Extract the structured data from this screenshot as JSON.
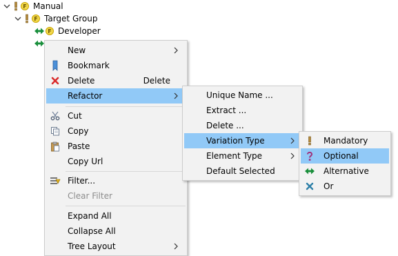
{
  "tree": {
    "items": [
      {
        "label": "Manual"
      },
      {
        "label": "Target Group"
      },
      {
        "label": "Developer"
      }
    ]
  },
  "context_menu": {
    "items": {
      "new": {
        "label": "New"
      },
      "bookmark": {
        "label": "Bookmark"
      },
      "delete": {
        "label": "Delete",
        "accelerator": "Delete"
      },
      "refactor": {
        "label": "Refactor"
      },
      "cut": {
        "label": "Cut"
      },
      "copy": {
        "label": "Copy"
      },
      "paste": {
        "label": "Paste"
      },
      "copy_url": {
        "label": "Copy Url"
      },
      "filter": {
        "label": "Filter..."
      },
      "clear_filter": {
        "label": "Clear Filter"
      },
      "expand_all": {
        "label": "Expand All"
      },
      "collapse_all": {
        "label": "Collapse All"
      },
      "tree_layout": {
        "label": "Tree Layout"
      }
    }
  },
  "refactor_menu": {
    "items": {
      "unique_name": {
        "label": "Unique Name ..."
      },
      "extract": {
        "label": "Extract ..."
      },
      "delete": {
        "label": "Delete ..."
      },
      "variation_type": {
        "label": "Variation Type"
      },
      "element_type": {
        "label": "Element Type"
      },
      "default_selected": {
        "label": "Default Selected"
      }
    }
  },
  "variation_menu": {
    "items": {
      "mandatory": {
        "label": "Mandatory"
      },
      "optional": {
        "label": "Optional"
      },
      "alternative": {
        "label": "Alternative"
      },
      "or": {
        "label": "Or"
      }
    }
  },
  "colors": {
    "selection": "#91c9f7",
    "menu_bg": "#f2f2f2",
    "feature_badge": "#f2d84a",
    "alternative": "#1a8f3c",
    "or": "#2d7fa8",
    "delete": "#d92b2b"
  }
}
